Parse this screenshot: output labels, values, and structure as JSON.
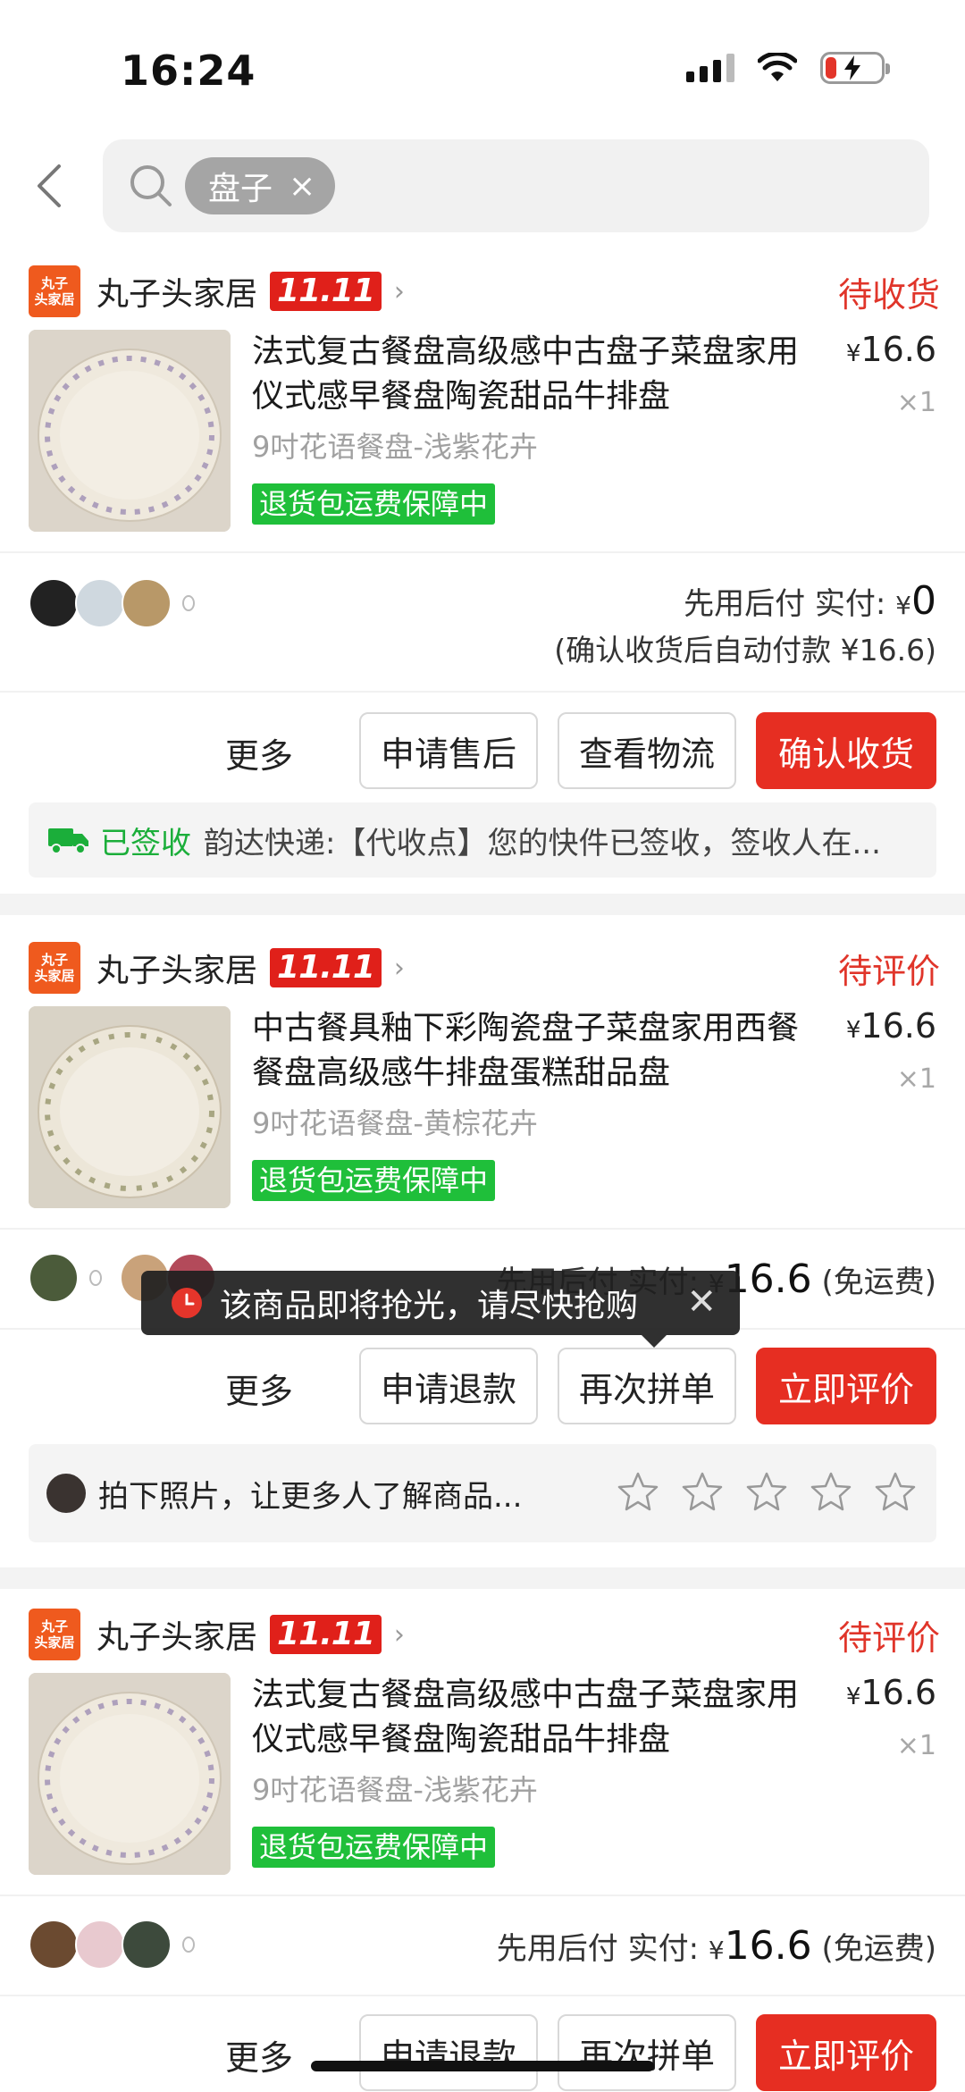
{
  "status_bar": {
    "time": "16:24"
  },
  "search": {
    "chip_text": "盘子",
    "chip_close": "×"
  },
  "orders": [
    {
      "shop_logo_text": [
        "丸子",
        "头家居"
      ],
      "shop_name": "丸子头家居",
      "promo_badge": "11.11",
      "status": "待收货",
      "title": "法式复古餐盘高级感中古盘子菜盘家用仪式感早餐盘陶瓷甜品牛排盘",
      "variant": "9吋花语餐盘-浅紫花卉",
      "tag": "退货包运费保障中",
      "price_symbol": "¥",
      "price": "16.6",
      "qty": "×1",
      "pay_label": "先用后付 实付:",
      "pay_symbol": "¥",
      "pay_amount": "0",
      "pay_note": "(确认收货后自动付款 ¥16.6)",
      "more": "更多",
      "buttons": [
        "申请售后",
        "查看物流",
        "确认收货"
      ],
      "logistics_status": "已签收",
      "logistics_text": "韵达快递:【代收点】您的快件已签收，签收人在..."
    },
    {
      "shop_logo_text": [
        "丸子",
        "头家居"
      ],
      "shop_name": "丸子头家居",
      "promo_badge": "11.11",
      "status": "待评价",
      "title": "中古餐具釉下彩陶瓷盘子菜盘家用西餐餐盘高级感牛排盘蛋糕甜品盘",
      "variant": "9吋花语餐盘-黄棕花卉",
      "tag": "退货包运费保障中",
      "price_symbol": "¥",
      "price": "16.6",
      "qty": "×1",
      "pay_label": "先用后付 实付:",
      "pay_symbol": "¥",
      "pay_amount": "16.6",
      "pay_suffix": "(免运费)",
      "more": "更多",
      "buttons": [
        "申请退款",
        "再次拼单",
        "立即评价"
      ],
      "review_prompt": "拍下照片，让更多人了解商品..."
    },
    {
      "shop_logo_text": [
        "丸子",
        "头家居"
      ],
      "shop_name": "丸子头家居",
      "promo_badge": "11.11",
      "status": "待评价",
      "title": "法式复古餐盘高级感中古盘子菜盘家用仪式感早餐盘陶瓷甜品牛排盘",
      "variant": "9吋花语餐盘-浅紫花卉",
      "tag": "退货包运费保障中",
      "price_symbol": "¥",
      "price": "16.6",
      "qty": "×1",
      "pay_label": "先用后付 实付:",
      "pay_symbol": "¥",
      "pay_amount": "16.6",
      "pay_suffix": "(免运费)",
      "more": "更多",
      "buttons": [
        "申请退款",
        "再次拼单",
        "立即评价"
      ]
    }
  ],
  "toast": {
    "text": "该商品即将抢光，请尽快抢购",
    "close": "✕"
  },
  "colors": {
    "accent_red": "#e62e22",
    "status_red": "#e0352a",
    "tag_green": "#1fbf3a",
    "signed_green": "#1bae3a"
  }
}
